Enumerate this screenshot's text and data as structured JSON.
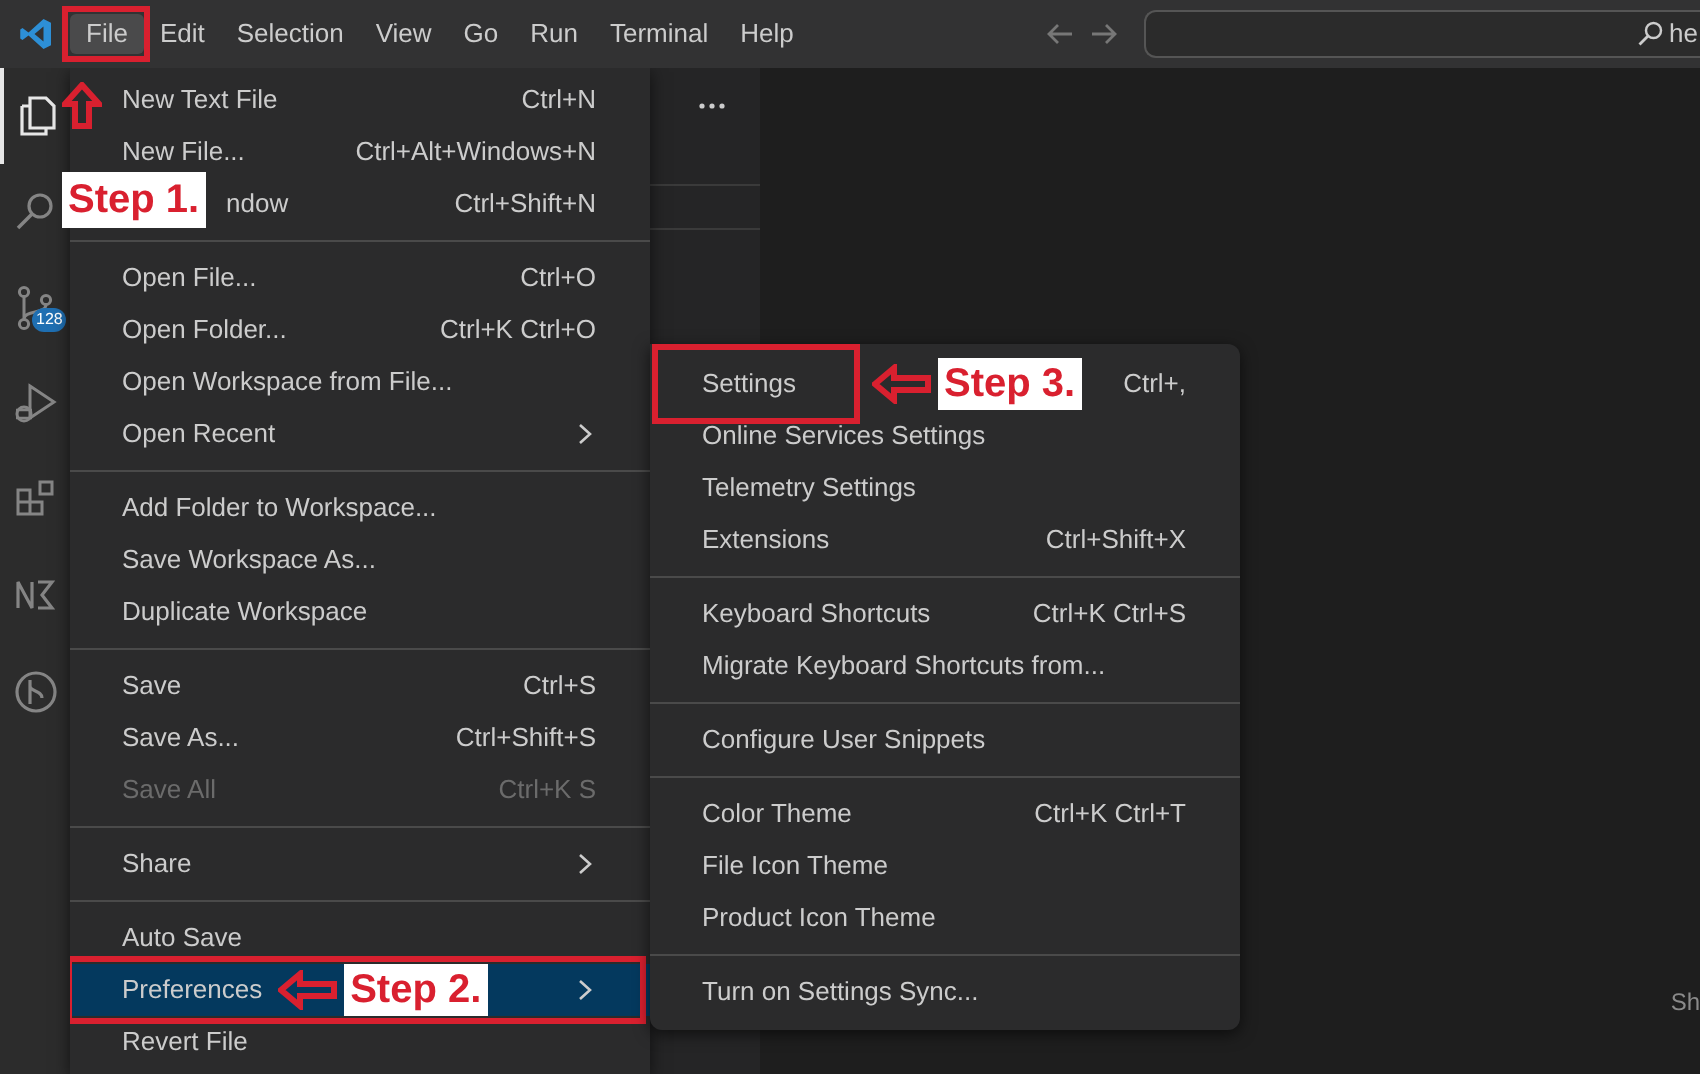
{
  "menubar": {
    "items": [
      {
        "label": "File",
        "selected": true,
        "callout": {
          "text": "Step 1."
        }
      },
      {
        "label": "Edit",
        "selected": false
      },
      {
        "label": "Selection",
        "selected": false
      },
      {
        "label": "View",
        "selected": false
      },
      {
        "label": "Go",
        "selected": false
      },
      {
        "label": "Run",
        "selected": false
      },
      {
        "label": "Terminal",
        "selected": false
      },
      {
        "label": "Help",
        "selected": false
      }
    ]
  },
  "search": {
    "value": "he"
  },
  "activity_bar": {
    "items": [
      {
        "kind": "files",
        "selected": true
      },
      {
        "kind": "search",
        "selected": false
      },
      {
        "kind": "source-control",
        "selected": false,
        "badge": "128"
      },
      {
        "kind": "run",
        "selected": false
      },
      {
        "kind": "extensions",
        "selected": false
      },
      {
        "kind": "notation",
        "selected": false
      },
      {
        "kind": "branch",
        "selected": false
      }
    ]
  },
  "file_menu": {
    "items": [
      {
        "kind": "item",
        "label": "New Text File",
        "shortcut": "Ctrl+N",
        "selected": false,
        "disabled": false,
        "submenu": false,
        "covered": false
      },
      {
        "kind": "item",
        "label": "New File...",
        "shortcut": "Ctrl+Alt+Windows+N",
        "selected": false,
        "disabled": false,
        "submenu": false,
        "covered": false
      },
      {
        "kind": "item",
        "label": "ndow",
        "shortcut": "Ctrl+Shift+N",
        "selected": false,
        "disabled": false,
        "submenu": false,
        "covered": true
      },
      {
        "kind": "separator"
      },
      {
        "kind": "item",
        "label": "Open File...",
        "shortcut": "Ctrl+O",
        "selected": false,
        "disabled": false,
        "submenu": false,
        "covered": false
      },
      {
        "kind": "item",
        "label": "Open Folder...",
        "shortcut": "Ctrl+K Ctrl+O",
        "selected": false,
        "disabled": false,
        "submenu": false,
        "covered": false
      },
      {
        "kind": "item",
        "label": "Open Workspace from File...",
        "selected": false,
        "disabled": false,
        "submenu": false,
        "covered": false
      },
      {
        "kind": "item",
        "label": "Open Recent",
        "selected": false,
        "disabled": false,
        "submenu": true,
        "covered": false
      },
      {
        "kind": "separator"
      },
      {
        "kind": "item",
        "label": "Add Folder to Workspace...",
        "selected": false,
        "disabled": false,
        "submenu": false,
        "covered": false
      },
      {
        "kind": "item",
        "label": "Save Workspace As...",
        "selected": false,
        "disabled": false,
        "submenu": false,
        "covered": false
      },
      {
        "kind": "item",
        "label": "Duplicate Workspace",
        "selected": false,
        "disabled": false,
        "submenu": false,
        "covered": false
      },
      {
        "kind": "separator"
      },
      {
        "kind": "item",
        "label": "Save",
        "shortcut": "Ctrl+S",
        "selected": false,
        "disabled": false,
        "submenu": false,
        "covered": false
      },
      {
        "kind": "item",
        "label": "Save As...",
        "shortcut": "Ctrl+Shift+S",
        "selected": false,
        "disabled": false,
        "submenu": false,
        "covered": false
      },
      {
        "kind": "item",
        "label": "Save All",
        "shortcut": "Ctrl+K S",
        "selected": false,
        "disabled": true,
        "submenu": false,
        "covered": false
      },
      {
        "kind": "separator"
      },
      {
        "kind": "item",
        "label": "Share",
        "selected": false,
        "disabled": false,
        "submenu": true,
        "covered": false
      },
      {
        "kind": "separator"
      },
      {
        "kind": "item",
        "label": "Auto Save",
        "selected": false,
        "disabled": false,
        "submenu": false,
        "covered": false
      },
      {
        "kind": "item",
        "label": "Preferences",
        "selected": true,
        "disabled": false,
        "submenu": true,
        "covered": false,
        "callout": {
          "text": "Step 2."
        }
      },
      {
        "kind": "item",
        "label": "Revert File",
        "selected": false,
        "disabled": false,
        "submenu": false,
        "covered": false
      }
    ]
  },
  "preferences_menu": {
    "items": [
      {
        "kind": "item",
        "label": "Settings",
        "shortcut": "Ctrl+,",
        "callout": {
          "text": "Step 3."
        }
      },
      {
        "kind": "item",
        "label": "Online Services Settings"
      },
      {
        "kind": "item",
        "label": "Telemetry Settings"
      },
      {
        "kind": "item",
        "label": "Extensions",
        "shortcut": "Ctrl+Shift+X"
      },
      {
        "kind": "separator"
      },
      {
        "kind": "item",
        "label": "Keyboard Shortcuts",
        "shortcut": "Ctrl+K Ctrl+S"
      },
      {
        "kind": "item",
        "label": "Migrate Keyboard Shortcuts from..."
      },
      {
        "kind": "separator"
      },
      {
        "kind": "item",
        "label": "Configure User Snippets"
      },
      {
        "kind": "separator"
      },
      {
        "kind": "item",
        "label": "Color Theme",
        "shortcut": "Ctrl+K Ctrl+T"
      },
      {
        "kind": "item",
        "label": "File Icon Theme"
      },
      {
        "kind": "item",
        "label": "Product Icon Theme"
      },
      {
        "kind": "separator"
      },
      {
        "kind": "item",
        "label": "Turn on Settings Sync..."
      }
    ]
  },
  "editor": {
    "hint": "Sh"
  }
}
